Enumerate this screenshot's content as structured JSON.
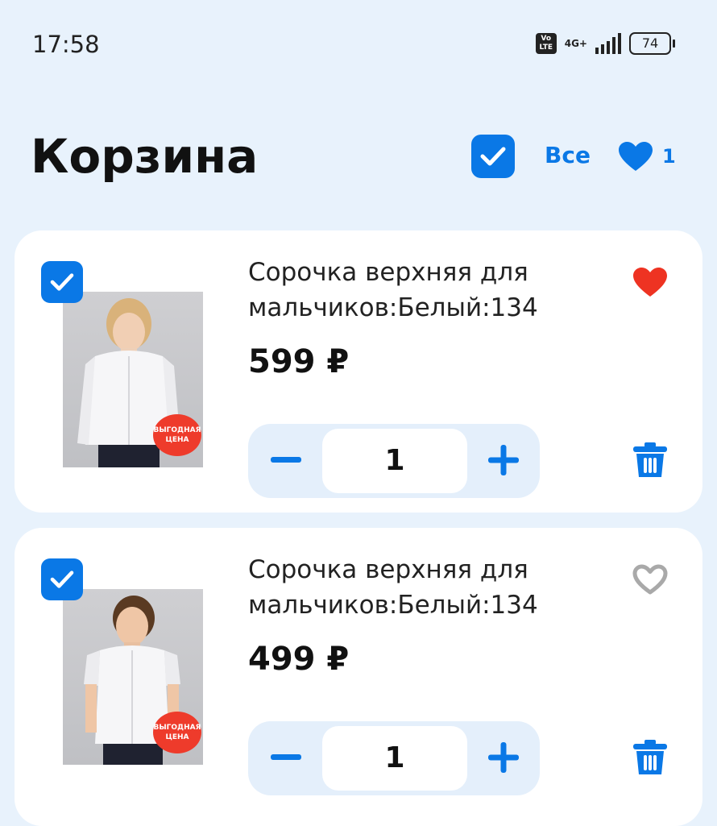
{
  "status_bar": {
    "time": "17:58",
    "volte": "Vo LTE",
    "network": "4G+",
    "battery": "74"
  },
  "header": {
    "title": "Корзина",
    "select_all_label": "Все",
    "favorites_count": "1"
  },
  "cart": {
    "items": [
      {
        "name": "Сорочка верхняя для мальчиков:Белый:134",
        "price": "599 ₽",
        "quantity": "1",
        "badge": "ВЫГОДНАЯ ЦЕНА",
        "selected": true,
        "favorited": true
      },
      {
        "name": "Сорочка верхняя для мальчиков:Белый:134",
        "price": "499 ₽",
        "quantity": "1",
        "badge": "ВЫГОДНАЯ ЦЕНА",
        "selected": true,
        "favorited": false
      }
    ]
  },
  "colors": {
    "accent": "#0a78e6",
    "background": "#e8f2fc",
    "favorite_active": "#ee3322",
    "favorite_inactive": "#a9a9a9",
    "badge": "#ee3b2b"
  }
}
